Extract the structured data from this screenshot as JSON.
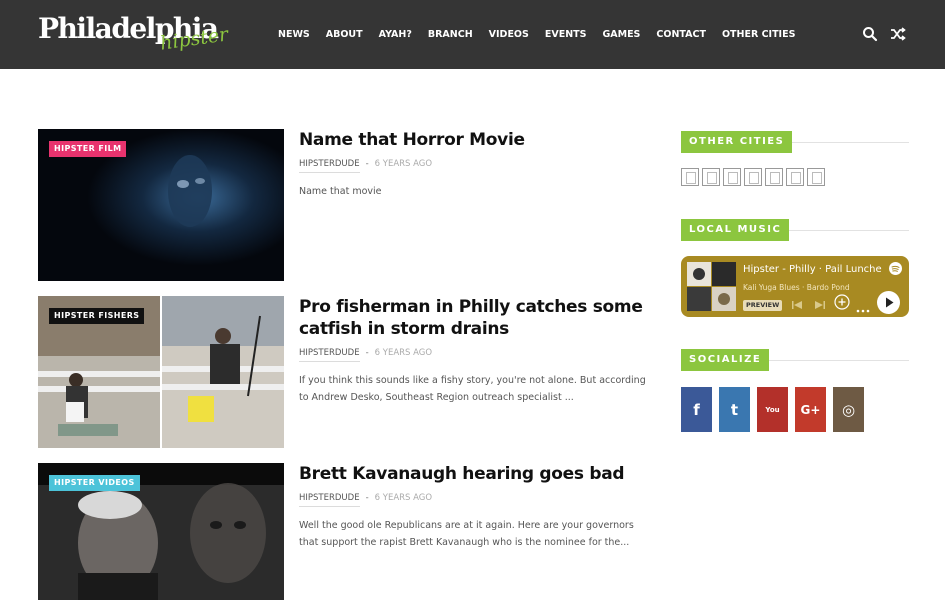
{
  "header": {
    "logo_main": "Philadelphia",
    "logo_sub": "hipster",
    "nav": [
      "NEWS",
      "ABOUT",
      "AYAH?",
      "BRANCH",
      "VIDEOS",
      "EVENTS",
      "GAMES",
      "CONTACT",
      "OTHER CITIES"
    ],
    "icons": [
      "search-icon",
      "shuffle-icon"
    ]
  },
  "posts": [
    {
      "category": "HIPSTER FILM",
      "category_color": "#e8336e",
      "title": "Name that Horror Movie",
      "author": "HIPSTERDUDE",
      "separator": "-",
      "time": "6 YEARS AGO",
      "excerpt": "Name that movie"
    },
    {
      "category": "HIPSTER FISHERS",
      "category_color": "#111111",
      "title": "Pro fisherman in Philly catches some catfish in storm drains",
      "author": "HIPSTERDUDE",
      "separator": "-",
      "time": "6 YEARS AGO",
      "excerpt": "If you think this sounds like a fishy story, you're not alone. But according to Andrew Desko, Southeast Region outreach specialist ..."
    },
    {
      "category": "HIPSTER VIDEOS",
      "category_color": "#4cc3d9",
      "title": "Brett Kavanaugh hearing goes bad",
      "author": "HIPSTERDUDE",
      "separator": "-",
      "time": "6 YEARS AGO",
      "excerpt": "Well the good ole Republicans are at it again. Here are your governors that support the rapist Brett Kavanaugh who is the nominee for the..."
    }
  ],
  "sidebar": {
    "other_cities_title": "OTHER CITIES",
    "city_icon_count": 7,
    "local_music_title": "LOCAL MUSIC",
    "spotify": {
      "title": "Hipster - Philly · Pail Lunche",
      "subtitle": "Kali Yuga Blues  ·  Bardo Pond",
      "preview": "PREVIEW",
      "bg_color": "#a88a22"
    },
    "socialize_title": "SOCIALIZE",
    "socials": [
      {
        "name": "facebook-icon",
        "glyph": "f",
        "color": "#3b5998"
      },
      {
        "name": "twitter-icon",
        "glyph": "t",
        "color": "#3a77b0"
      },
      {
        "name": "youtube-icon",
        "glyph": "You",
        "color": "#b3302a"
      },
      {
        "name": "google-plus-icon",
        "glyph": "G+",
        "color": "#c23a2b"
      },
      {
        "name": "instagram-icon",
        "glyph": "◎",
        "color": "#6e5a44"
      }
    ]
  },
  "colors": {
    "header_bg": "#353535",
    "accent_green": "#8cc63f"
  }
}
